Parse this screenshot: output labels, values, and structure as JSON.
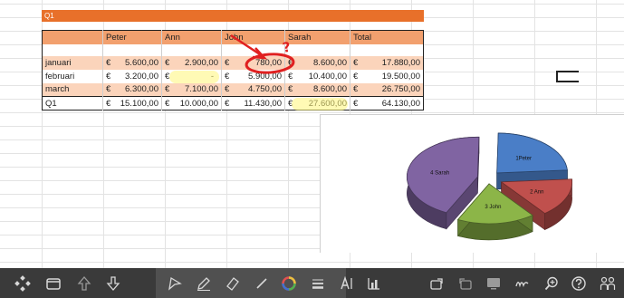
{
  "sheet": {
    "title": "Q1",
    "columns": [
      "",
      "Peter",
      "Ann",
      "John",
      "Sarah",
      "Total"
    ],
    "rows": [
      {
        "label": "januari",
        "peter": "5.600,00",
        "ann": "2.900,00",
        "john": "780,00",
        "sarah": "8.600,00",
        "total": "17.880,00"
      },
      {
        "label": "februari",
        "peter": "3.200,00",
        "ann": "-",
        "john": "5.900,00",
        "sarah": "10.400,00",
        "total": "19.500,00"
      },
      {
        "label": "march",
        "peter": "6.300,00",
        "ann": "7.100,00",
        "john": "4.750,00",
        "sarah": "8.600,00",
        "total": "26.750,00"
      },
      {
        "label": "Q1",
        "peter": "15.100,00",
        "ann": "10.000,00",
        "john": "11.430,00",
        "sarah": "27.600,00",
        "total": "64.130,00"
      }
    ],
    "currency": "€"
  },
  "chart_data": {
    "type": "pie",
    "categories": [
      "1Peter",
      "2 Ann",
      "3 John",
      "4 Sarah"
    ],
    "values": [
      15100,
      10000,
      11430,
      27600
    ],
    "colors": [
      "#4a7ec7",
      "#c0504d",
      "#8cb548",
      "#8064a2"
    ],
    "title": "",
    "legend": "none",
    "exploded": true,
    "style": "3d"
  },
  "annotation": {
    "mark": "?",
    "color": "#e02020"
  },
  "toolbar": {
    "icons": [
      "home-diamond-icon",
      "window-icon",
      "up-arrow-icon",
      "down-arrow-icon",
      "select-cursor-icon",
      "pen-icon",
      "eraser-icon",
      "line-icon",
      "color-wheel-icon",
      "line-weight-icon",
      "text-icon",
      "chart-icon",
      "undo-icon",
      "redo-icon",
      "screen-icon",
      "handwriting-icon",
      "zoom-icon",
      "help-icon",
      "users-icon"
    ]
  }
}
